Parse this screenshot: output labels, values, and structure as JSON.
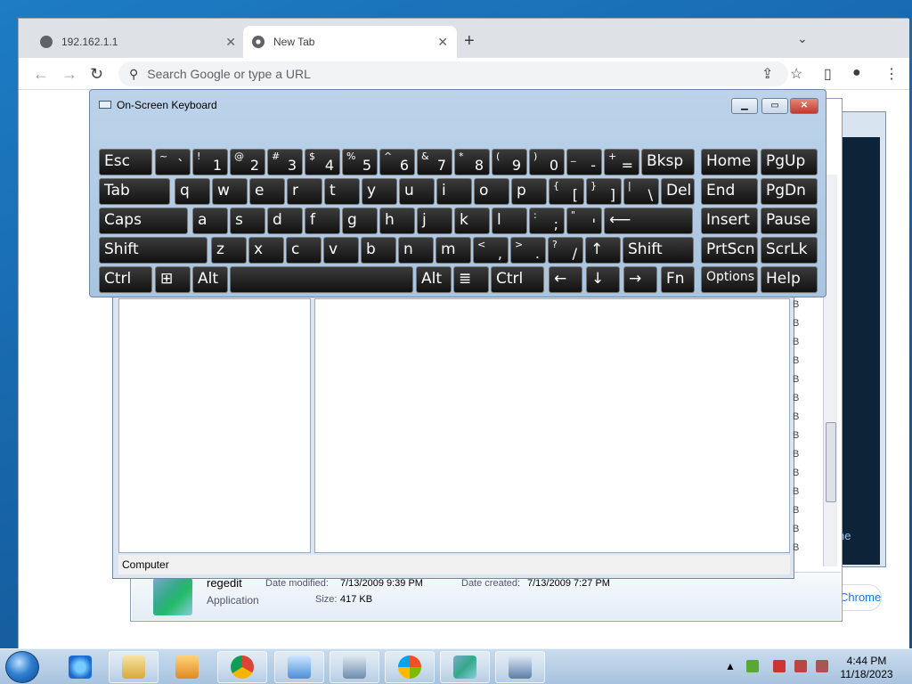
{
  "chrome": {
    "tabs": [
      {
        "title": "192.162.1.1",
        "close": "✕"
      },
      {
        "title": "New Tab",
        "close": "✕"
      }
    ],
    "newtab": "+",
    "tabsearch": "⌄",
    "omnibox_placeholder": "Search Google or type a URL",
    "hint": "Chrome"
  },
  "osk": {
    "title": "On-Screen Keyboard",
    "keys": [
      [
        {
          "l": "Esc"
        },
        {
          "t": "~",
          "b": "`"
        },
        {
          "t": "!",
          "b": "1"
        },
        {
          "t": "@",
          "b": "2"
        },
        {
          "t": "#",
          "b": "3"
        },
        {
          "t": "$",
          "b": "4"
        },
        {
          "t": "%",
          "b": "5"
        },
        {
          "t": "^",
          "b": "6"
        },
        {
          "t": "&",
          "b": "7"
        },
        {
          "t": "*",
          "b": "8"
        },
        {
          "t": "(",
          "b": "9"
        },
        {
          "t": ")",
          "b": "0"
        },
        {
          "t": "_",
          "b": "-"
        },
        {
          "t": "+",
          "b": "="
        },
        {
          "l": "Bksp"
        },
        {
          "l": "Home"
        },
        {
          "l": "PgUp"
        }
      ],
      [
        {
          "l": "Tab"
        },
        {
          "l": "q"
        },
        {
          "l": "w"
        },
        {
          "l": "e"
        },
        {
          "l": "r"
        },
        {
          "l": "t"
        },
        {
          "l": "y"
        },
        {
          "l": "u"
        },
        {
          "l": "i"
        },
        {
          "l": "o"
        },
        {
          "l": "p"
        },
        {
          "t": "{",
          "b": "["
        },
        {
          "t": "}",
          "b": "]"
        },
        {
          "t": "|",
          "b": "\\"
        },
        {
          "l": "Del"
        },
        {
          "l": "End"
        },
        {
          "l": "PgDn"
        }
      ],
      [
        {
          "l": "Caps"
        },
        {
          "l": "a"
        },
        {
          "l": "s"
        },
        {
          "l": "d"
        },
        {
          "l": "f"
        },
        {
          "l": "g"
        },
        {
          "l": "h"
        },
        {
          "l": "j"
        },
        {
          "l": "k"
        },
        {
          "l": "l"
        },
        {
          "t": ":",
          "b": ";"
        },
        {
          "t": "\"",
          "b": "'"
        },
        {
          "l": "⟵"
        },
        {
          "l": "Insert"
        },
        {
          "l": "Pause"
        }
      ],
      [
        {
          "l": "Shift"
        },
        {
          "l": "z"
        },
        {
          "l": "x"
        },
        {
          "l": "c"
        },
        {
          "l": "v"
        },
        {
          "l": "b"
        },
        {
          "l": "n"
        },
        {
          "l": "m"
        },
        {
          "t": "<",
          "b": ","
        },
        {
          "t": ">",
          "b": "."
        },
        {
          "t": "?",
          "b": "/"
        },
        {
          "l": "↑"
        },
        {
          "l": "Shift"
        },
        {
          "l": "PrtScn"
        },
        {
          "l": "ScrLk"
        }
      ],
      [
        {
          "l": "Ctrl"
        },
        {
          "l": "⊞"
        },
        {
          "l": "Alt"
        },
        {
          "l": ""
        },
        {
          "l": "Alt"
        },
        {
          "l": "≣"
        },
        {
          "l": "Ctrl"
        },
        {
          "l": "←"
        },
        {
          "l": "↓"
        },
        {
          "l": "→"
        },
        {
          "l": "Fn"
        },
        {
          "l": "Options"
        },
        {
          "l": "Help"
        }
      ]
    ]
  },
  "regedit": {
    "status": "Computer"
  },
  "details": {
    "name": "regedit",
    "type": "Application",
    "modified_label": "Date modified:",
    "modified": "7/13/2009 9:39 PM",
    "created_label": "Date created:",
    "created": "7/13/2009 7:27 PM",
    "size_label": "Size:",
    "size": "417 KB"
  },
  "bcol": [
    "B",
    "B",
    "B",
    "B",
    "B",
    "B",
    "B",
    "B",
    "B",
    "B",
    "B",
    "B",
    "B",
    "B"
  ],
  "darkwin_label": "ne",
  "taskbar": {
    "time": "4:44 PM",
    "date": "11/18/2023"
  }
}
